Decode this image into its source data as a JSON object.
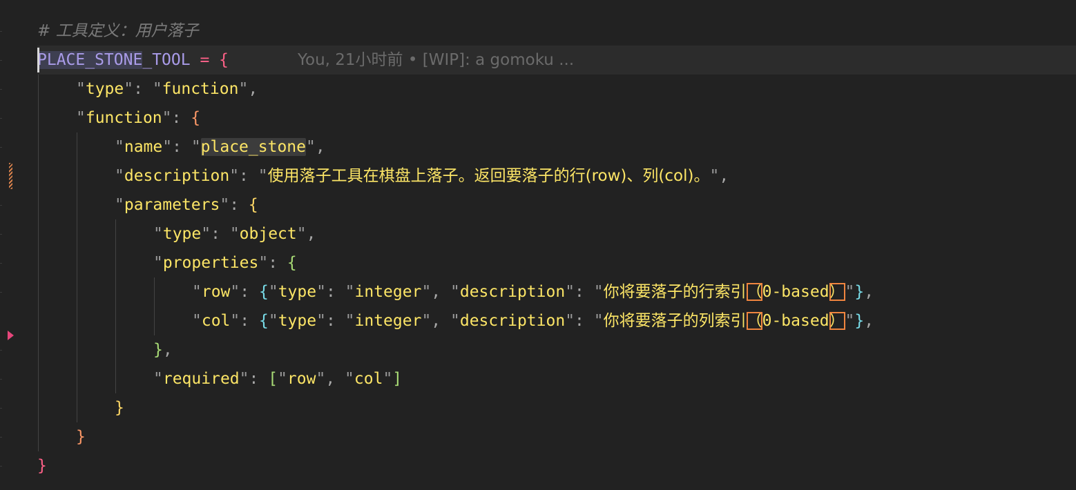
{
  "editor": {
    "comment": "# 工具定义：用户落子",
    "blame": "You, 21小时前 • [WIP]: a gomoku ...",
    "var_name_a": "PLACE_STONE",
    "var_name_b": "_TOOL",
    "eq": "=",
    "key_type": "type",
    "val_function": "function",
    "key_function": "function",
    "key_name": "name",
    "val_name": "place_stone",
    "key_description": "description",
    "val_description": "使用落子工具在棋盘上落子。返回要落子的行(row)、列(col)。",
    "key_parameters": "parameters",
    "val_object": "object",
    "key_properties": "properties",
    "key_row": "row",
    "key_col": "col",
    "val_integer": "integer",
    "row_desc_cjk": "你将要落子的行索引",
    "col_desc_cjk": "你将要落子的列索引",
    "desc_paren_open": "（",
    "desc_inner": "0-based",
    "desc_paren_close": "）",
    "key_required": "required",
    "req_row": "row",
    "req_col": "col"
  },
  "colors": {
    "background": "#222222",
    "variable": "#a99be8",
    "string": "#fce566",
    "operator": "#ff6188",
    "comment": "#7a7a7a",
    "box_highlight": "#f0853f"
  }
}
